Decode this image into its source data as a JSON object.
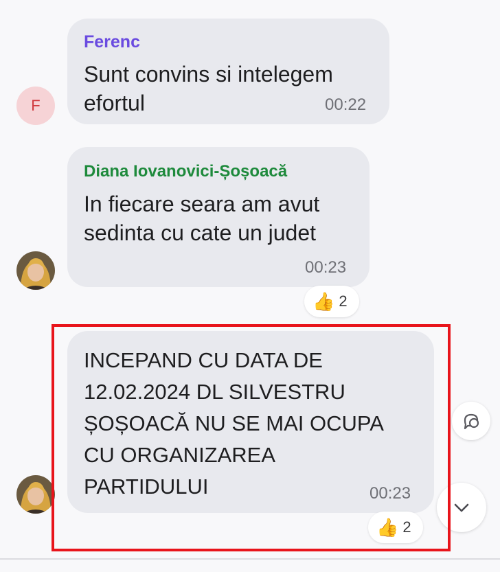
{
  "messages": [
    {
      "sender": "Ferenc",
      "sender_color": "#6a4be0",
      "text": "Sunt convins si intelegem\nefortul",
      "time": "00:22",
      "avatar_letter": "F"
    },
    {
      "sender": "Diana Iovanovici-Șoșoacă",
      "sender_color": "#1e8a3c",
      "text": "In fiecare seara am avut\nsedinta cu cate un judet",
      "time": "00:23",
      "reaction": {
        "emoji": "👍",
        "count": "2"
      }
    },
    {
      "text": "INCEPAND CU DATA DE\n12.02.2024 DL SILVESTRU\nȘOȘOACĂ NU SE MAI OCUPA\nCU ORGANIZAREA\nPARTIDULUI",
      "time": "00:23",
      "reaction": {
        "emoji": "👍",
        "count": "2"
      }
    }
  ],
  "icons": {
    "reply": "reply-bubble-icon",
    "scroll_down": "chevron-down-icon"
  },
  "highlight_color": "#e8141b"
}
